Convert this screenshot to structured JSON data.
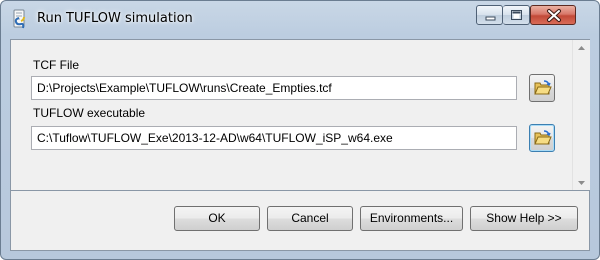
{
  "window": {
    "title": "Run TUFLOW simulation",
    "icon": "python-script-icon"
  },
  "fields": {
    "tcf": {
      "label": "TCF File",
      "value": "D:\\Projects\\Example\\TUFLOW\\runs\\Create_Empties.tcf"
    },
    "exe": {
      "label": "TUFLOW executable",
      "value": "C:\\Tuflow\\TUFLOW_Exe\\2013-12-AD\\w64\\TUFLOW_iSP_w64.exe"
    }
  },
  "buttons": {
    "ok": "OK",
    "cancel": "Cancel",
    "environments": "Environments...",
    "show_help": "Show Help >>"
  },
  "icons": {
    "browse": "open-folder-icon",
    "minimize": "minimize-icon",
    "maximize": "maximize-icon",
    "close": "close-icon"
  },
  "colors": {
    "frame": "#bccde0",
    "close_button": "#c24a38",
    "client_background": "#f0f0f0"
  }
}
